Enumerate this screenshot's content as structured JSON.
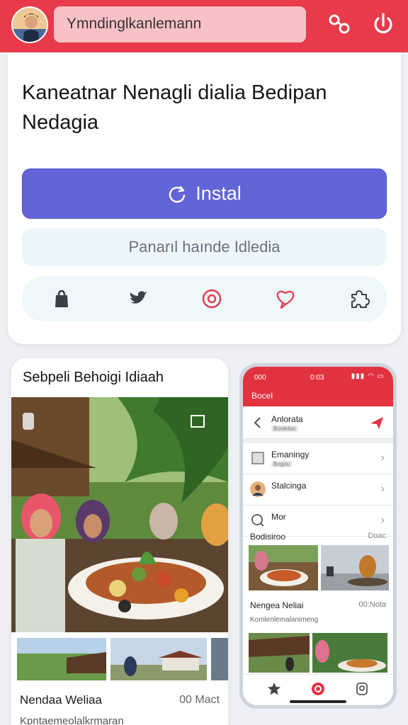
{
  "topbar": {
    "url_text": "Ymndinglkanlemann",
    "icons": [
      "avatar",
      "share-icon",
      "power-icon"
    ]
  },
  "install_card": {
    "title": "Kaneatnar Nenagli dialia Bedipan Nedagia",
    "install_label": "Instal",
    "secondary_label": "Panarıl haınde Idledia",
    "share_icons": [
      "bag-icon",
      "twitter-icon",
      "instagram-icon",
      "heart-chat-icon",
      "puzzle-icon"
    ]
  },
  "article_card": {
    "title": "Sebpeli Behoigi Idiaah",
    "caption": "Nendaa Weliaa",
    "caption_meta": "00 Mact",
    "caption_sub": "Kpntaemeolalkrmaran"
  },
  "phone": {
    "status_time_left": "000",
    "status_time_mid": "0:03",
    "header": "Bocel",
    "rows": [
      {
        "label": "Anlorata",
        "sub": "Booleloo"
      },
      {
        "label": "Emaningy",
        "sub": "Bogou"
      },
      {
        "label": "Stalcinga",
        "sub": ""
      },
      {
        "label": "Mor",
        "sub": ""
      }
    ],
    "section_title": "Bodisiroo",
    "section_more": "Doac",
    "caption": "Nengea Neliai",
    "caption_meta": "00:Nota",
    "caption_sub": "Komlenlemalanimeng"
  },
  "colors": {
    "brand_red": "#e83a4a",
    "install_purple": "#6264d8"
  }
}
